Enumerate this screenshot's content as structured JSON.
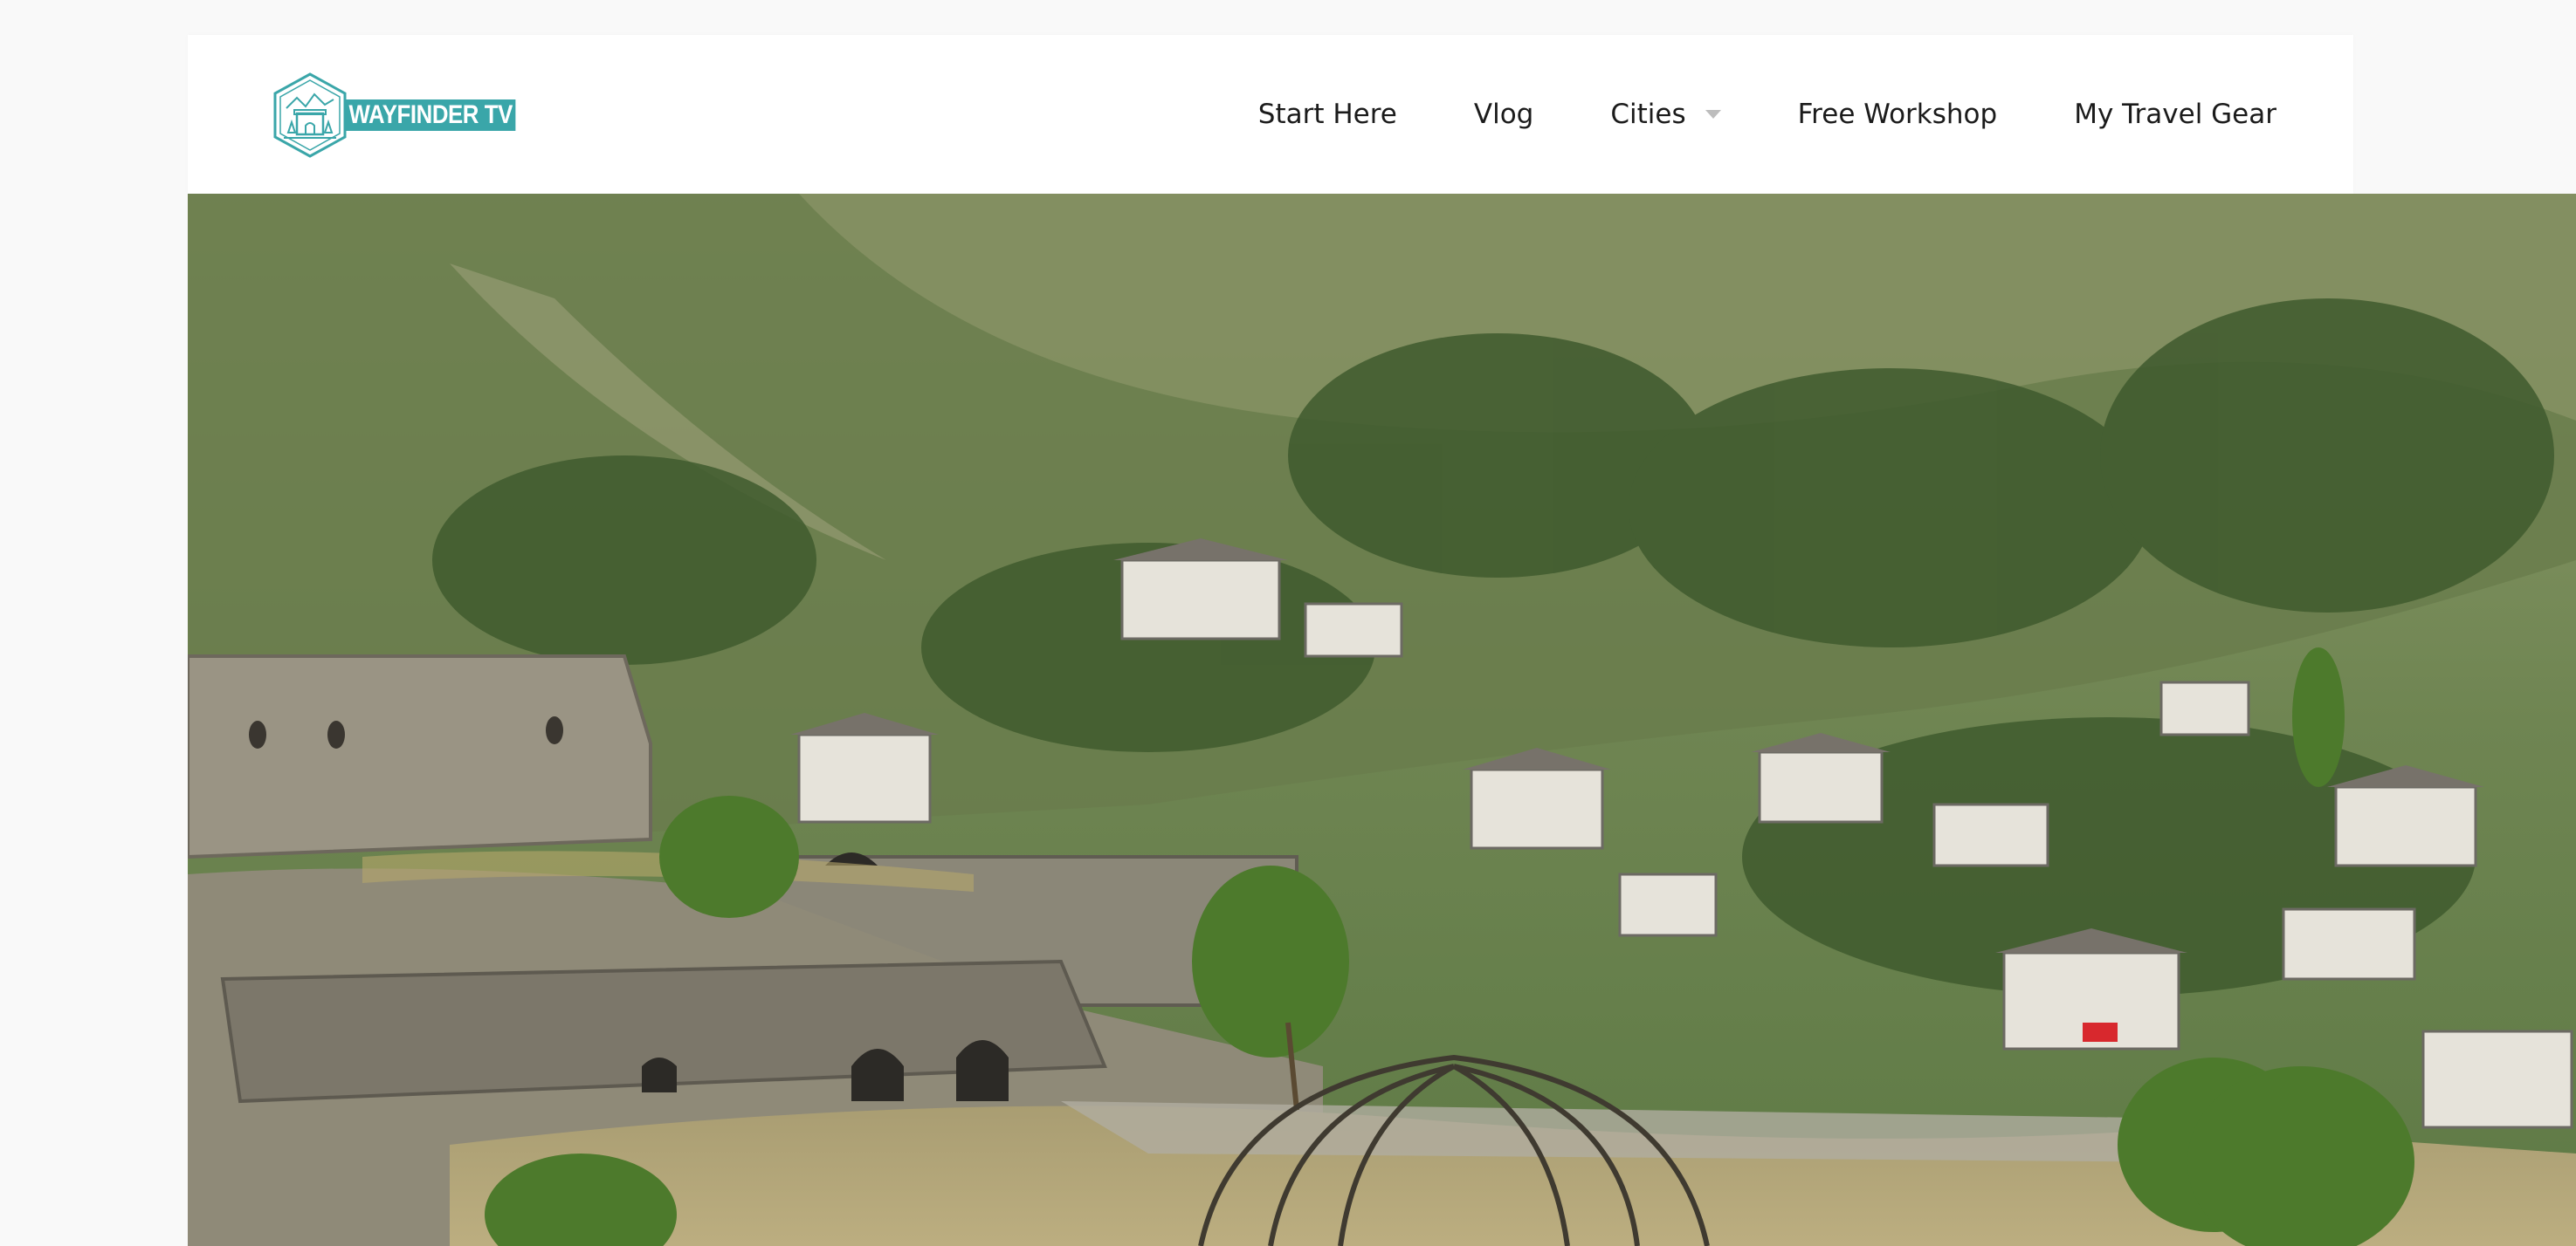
{
  "brand": {
    "logo_text": "WAYFINDER TV",
    "accent_color": "#3aa6a9"
  },
  "nav": {
    "items": [
      {
        "label": "Start Here"
      },
      {
        "label": "Vlog"
      },
      {
        "label": "Cities",
        "has_dropdown": true
      },
      {
        "label": "Free Workshop"
      },
      {
        "label": "My Travel Gear"
      }
    ]
  },
  "hero": {
    "image_icon": "landscape-photo-icon"
  }
}
